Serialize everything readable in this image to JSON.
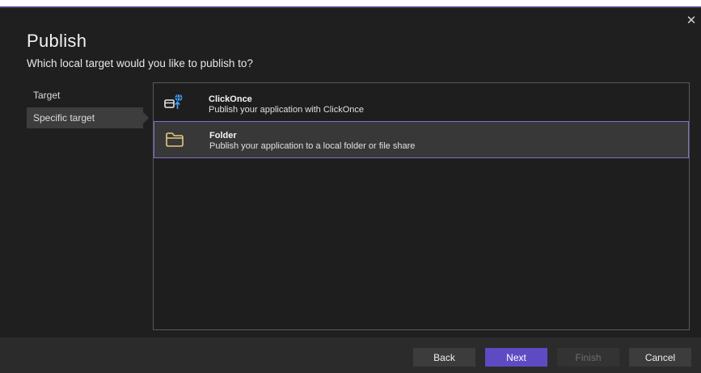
{
  "dialog": {
    "title": "Publish",
    "subtitle": "Which local target would you like to publish to?",
    "close_glyph": "✕"
  },
  "nav": {
    "items": [
      {
        "label": "Target",
        "selected": false
      },
      {
        "label": "Specific target",
        "selected": true
      }
    ]
  },
  "targets": [
    {
      "title": "ClickOnce",
      "description": "Publish your application with ClickOnce",
      "icon": "clickonce-icon",
      "selected": false
    },
    {
      "title": "Folder",
      "description": "Publish your application to a local folder or file share",
      "icon": "folder-icon",
      "selected": true
    }
  ],
  "footer": {
    "back_label": "Back",
    "next_label": "Next",
    "finish_label": "Finish",
    "cancel_label": "Cancel"
  },
  "colors": {
    "accent": "#5e4bc4",
    "selection_border": "#7f70c8",
    "folder_icon": "#e8c77a",
    "clickonce_globe": "#3fa4ff"
  }
}
